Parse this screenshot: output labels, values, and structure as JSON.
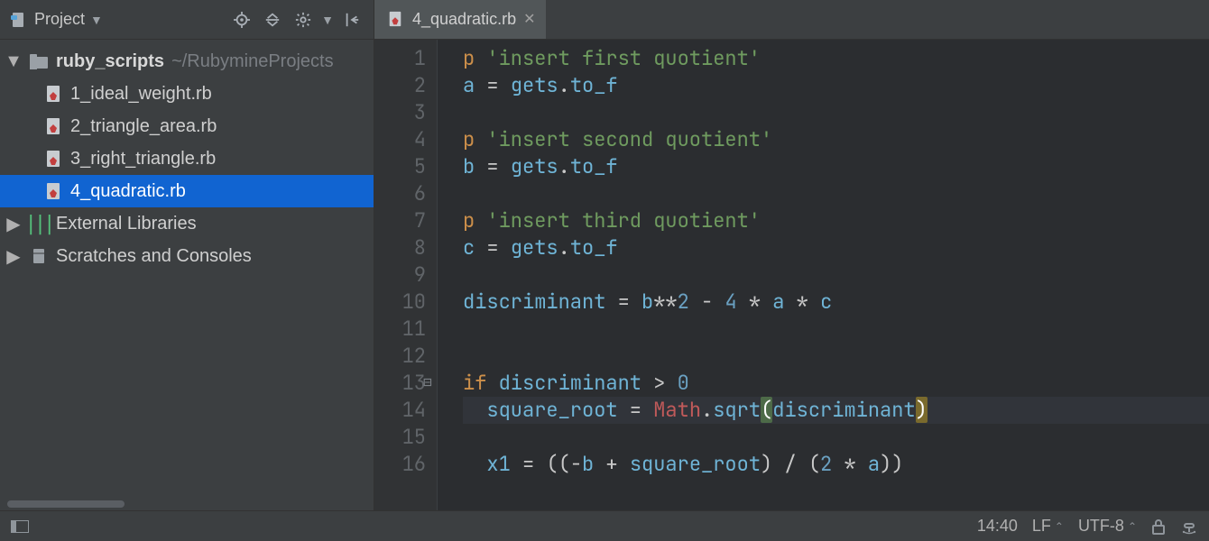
{
  "sidebar": {
    "title": "Project",
    "root": {
      "label": "ruby_scripts",
      "path": "~/RubymineProjects"
    },
    "files": [
      {
        "label": "1_ideal_weight.rb",
        "selected": false
      },
      {
        "label": "2_triangle_area.rb",
        "selected": false
      },
      {
        "label": "3_right_triangle.rb",
        "selected": false
      },
      {
        "label": "4_quadratic.rb",
        "selected": true
      }
    ],
    "extlib": "External Libraries",
    "scratches": "Scratches and Consoles"
  },
  "tab": {
    "label": "4_quadratic.rb"
  },
  "code": {
    "lines": [
      {
        "n": 1,
        "tokens": [
          [
            "method",
            "p "
          ],
          [
            "str",
            "'insert first quotient'"
          ]
        ]
      },
      {
        "n": 2,
        "tokens": [
          [
            "ident",
            "a"
          ],
          [
            "op",
            " = "
          ],
          [
            "ident",
            "gets"
          ],
          [
            "op",
            "."
          ],
          [
            "ident",
            "to_f"
          ]
        ]
      },
      {
        "n": 3,
        "tokens": []
      },
      {
        "n": 4,
        "tokens": [
          [
            "method",
            "p "
          ],
          [
            "str",
            "'insert second quotient'"
          ]
        ]
      },
      {
        "n": 5,
        "tokens": [
          [
            "ident",
            "b"
          ],
          [
            "op",
            " = "
          ],
          [
            "ident",
            "gets"
          ],
          [
            "op",
            "."
          ],
          [
            "ident",
            "to_f"
          ]
        ]
      },
      {
        "n": 6,
        "tokens": []
      },
      {
        "n": 7,
        "tokens": [
          [
            "method",
            "p "
          ],
          [
            "str",
            "'insert third quotient'"
          ]
        ]
      },
      {
        "n": 8,
        "tokens": [
          [
            "ident",
            "c"
          ],
          [
            "op",
            " = "
          ],
          [
            "ident",
            "gets"
          ],
          [
            "op",
            "."
          ],
          [
            "ident",
            "to_f"
          ]
        ]
      },
      {
        "n": 9,
        "tokens": []
      },
      {
        "n": 10,
        "tokens": [
          [
            "ident",
            "discriminant"
          ],
          [
            "op",
            " = "
          ],
          [
            "ident",
            "b"
          ],
          [
            "op",
            "**"
          ],
          [
            "num",
            "2"
          ],
          [
            "op",
            " - "
          ],
          [
            "num",
            "4"
          ],
          [
            "op",
            " * "
          ],
          [
            "ident",
            "a"
          ],
          [
            "op",
            " * "
          ],
          [
            "ident",
            "c"
          ]
        ]
      },
      {
        "n": 11,
        "tokens": []
      },
      {
        "n": 12,
        "tokens": []
      },
      {
        "n": 13,
        "tokens": [
          [
            "kw",
            "if "
          ],
          [
            "ident",
            "discriminant"
          ],
          [
            "op",
            " > "
          ],
          [
            "num",
            "0"
          ]
        ],
        "fold": true
      },
      {
        "n": 14,
        "tokens": [
          [
            "pad",
            "  "
          ],
          [
            "ident",
            "square_root"
          ],
          [
            "op",
            " = "
          ],
          [
            "const",
            "Math"
          ],
          [
            "op",
            "."
          ],
          [
            "ident",
            "sqrt"
          ],
          [
            "paren1",
            "("
          ],
          [
            "ident",
            "discriminant"
          ],
          [
            "paren2",
            ")"
          ]
        ],
        "hl": true
      },
      {
        "n": 15,
        "tokens": []
      },
      {
        "n": 16,
        "tokens": [
          [
            "pad",
            "  "
          ],
          [
            "ident",
            "x1"
          ],
          [
            "op",
            " = ((-"
          ],
          [
            "ident",
            "b"
          ],
          [
            "op",
            " + "
          ],
          [
            "ident",
            "square_root"
          ],
          [
            "op",
            ") / ("
          ],
          [
            "num",
            "2"
          ],
          [
            "op",
            " * "
          ],
          [
            "ident",
            "a"
          ],
          [
            "op",
            "))"
          ]
        ]
      }
    ]
  },
  "status": {
    "cursor": "14:40",
    "lineend": "LF",
    "encoding": "UTF-8"
  }
}
